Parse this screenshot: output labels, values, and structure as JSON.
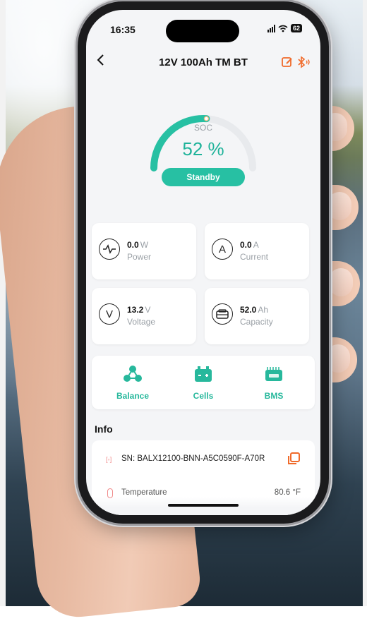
{
  "status_bar": {
    "time": "16:35",
    "battery": "62"
  },
  "header": {
    "title": "12V 100Ah TM BT",
    "back_icon": "chevron-left-icon",
    "edit_icon": "edit-icon",
    "bluetooth_icon": "bluetooth-icon",
    "accent": "#f06a2a"
  },
  "soc": {
    "label": "SOC",
    "value": "52 %",
    "percent": 52,
    "status": "Standby",
    "accent": "#27c0a3"
  },
  "metrics": [
    {
      "value": "0.0",
      "unit": "W",
      "label": "Power",
      "icon": "pulse-icon"
    },
    {
      "value": "0.0",
      "unit": "A",
      "label": "Current",
      "icon": "ampere-icon"
    },
    {
      "value": "13.2",
      "unit": "V",
      "label": "Voltage",
      "icon": "volt-icon"
    },
    {
      "value": "52.0",
      "unit": "Ah",
      "label": "Capacity",
      "icon": "battery-capacity-icon"
    }
  ],
  "actions": [
    {
      "label": "Balance",
      "icon": "balance-icon"
    },
    {
      "label": "Cells",
      "icon": "cells-icon"
    },
    {
      "label": "BMS",
      "icon": "bms-icon"
    }
  ],
  "info": {
    "title": "Info",
    "sn": "SN: BALX12100-BNN-A5C0590F-A70R",
    "temperature_label": "Temperature",
    "temperature_value": "80.6 °F"
  }
}
